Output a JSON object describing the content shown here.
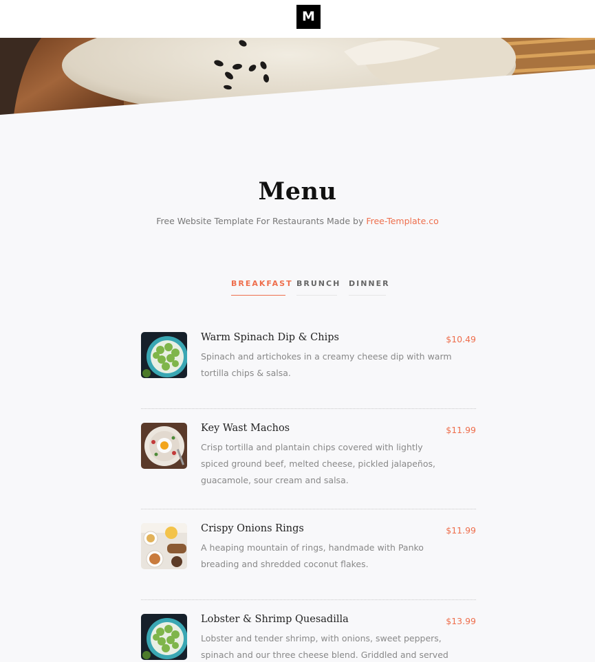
{
  "header": {
    "logo_text": "M"
  },
  "section": {
    "title": "Menu",
    "subtitle_prefix": "Free Website Template For Restaurants Made by ",
    "subtitle_link": "Free-Template.co"
  },
  "tabs": [
    {
      "label": "BREAKFAST",
      "active": true
    },
    {
      "label": "BRUNCH",
      "active": false
    },
    {
      "label": "DINNER",
      "active": false
    }
  ],
  "menu_items": [
    {
      "name": "Warm Spinach Dip & Chips",
      "price": "$10.49",
      "description": "Spinach and artichokes in a creamy cheese dip with warm tortilla chips & salsa.",
      "image": "dumplings-plate-image"
    },
    {
      "name": "Key Wast Machos",
      "price": "$11.99",
      "description": "Crisp tortilla and plantain chips covered with lightly spiced ground beef, melted cheese, pickled jalapeños, guacamole, sour cream and salsa.",
      "image": "egg-plate-image"
    },
    {
      "name": "Crispy Onions Rings",
      "price": "$11.99",
      "description": "A heaping mountain of rings, handmade with Panko breading and shredded coconut flakes.",
      "image": "table-dishes-image"
    },
    {
      "name": "Lobster & Shrimp Quesadilla",
      "price": "$13.99",
      "description": "Lobster and tender shrimp, with onions, sweet peppers, spinach and our three cheese blend. Griddled and served",
      "image": "dumplings-plate-image"
    }
  ],
  "colors": {
    "accent": "#ee6e4c",
    "background": "#f8f8fa",
    "logo_bg": "#000000"
  }
}
